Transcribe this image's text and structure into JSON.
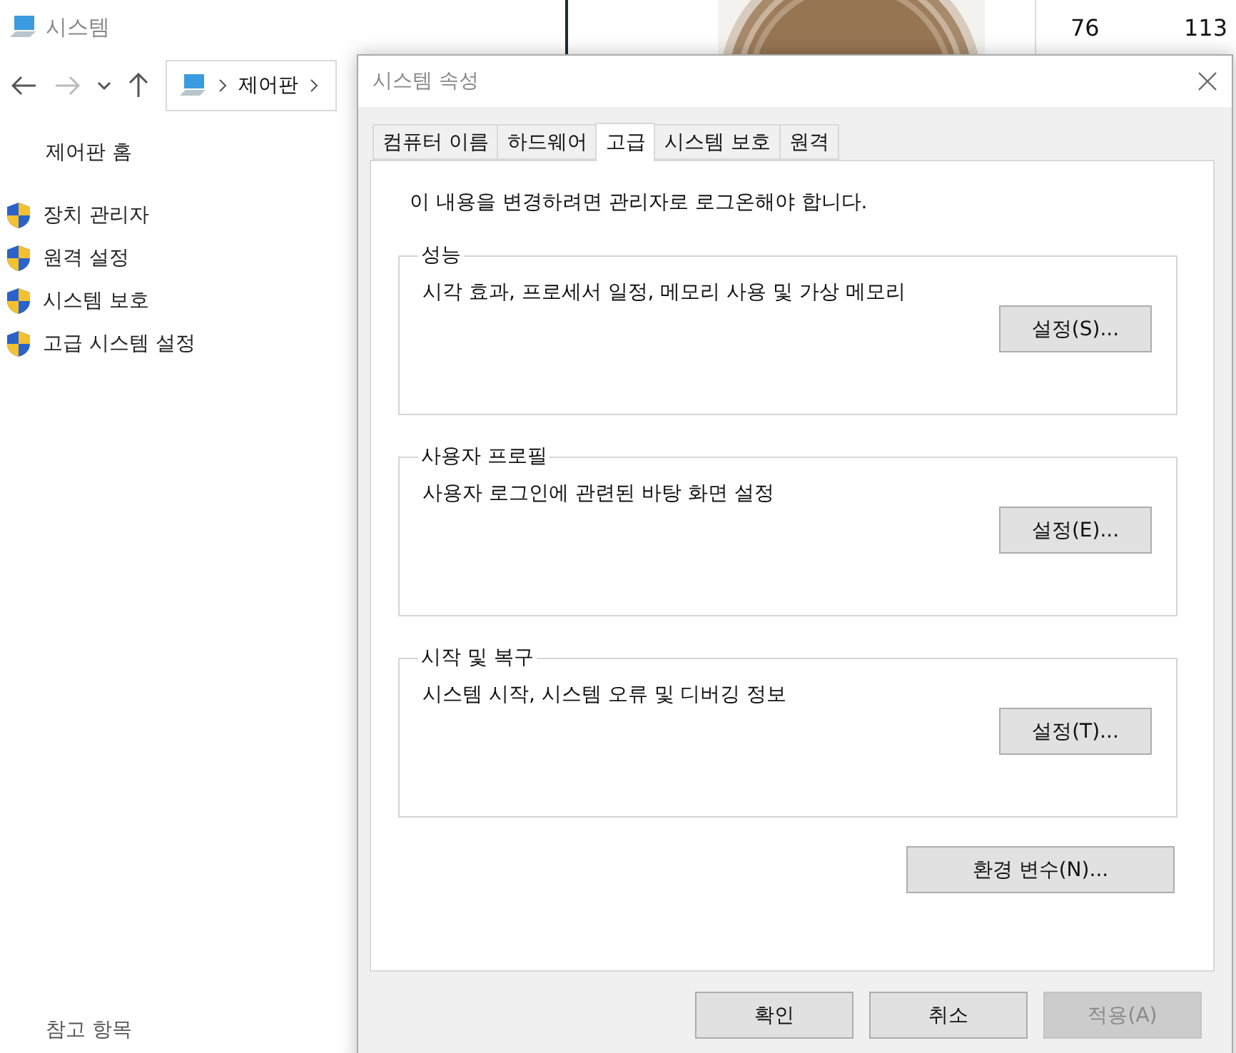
{
  "window": {
    "title": "시스템"
  },
  "breadcrumb": [
    "제어판"
  ],
  "sidebar": {
    "home": "제어판 홈",
    "items": [
      "장치 관리자",
      "원격 설정",
      "시스템 보호",
      "고급 시스템 설정"
    ],
    "footer": "참고 항목"
  },
  "background_cells": [
    "76",
    "113"
  ],
  "dialog": {
    "title": "시스템 속성",
    "tabs": [
      {
        "label": "컴퓨터 이름",
        "selected": false
      },
      {
        "label": "하드웨어",
        "selected": false
      },
      {
        "label": "고급",
        "selected": true
      },
      {
        "label": "시스템 보호",
        "selected": false
      },
      {
        "label": "원격",
        "selected": false
      }
    ],
    "notice": "이 내용을 변경하려면 관리자로 로그온해야 합니다.",
    "groups": [
      {
        "title": "성능",
        "description": "시각 효과, 프로세서 일정, 메모리 사용 및 가상 메모리",
        "button": "설정(S)..."
      },
      {
        "title": "사용자 프로필",
        "description": "사용자 로그인에 관련된 바탕 화면 설정",
        "button": "설정(E)..."
      },
      {
        "title": "시작 및 복구",
        "description": "시스템 시작, 시스템 오류 및 디버깅 정보",
        "button": "설정(T)..."
      }
    ],
    "env_button": "환경 변수(N)...",
    "buttons": [
      {
        "label": "확인",
        "disabled": false
      },
      {
        "label": "취소",
        "disabled": false
      },
      {
        "label": "적용(A)",
        "disabled": true
      }
    ]
  }
}
